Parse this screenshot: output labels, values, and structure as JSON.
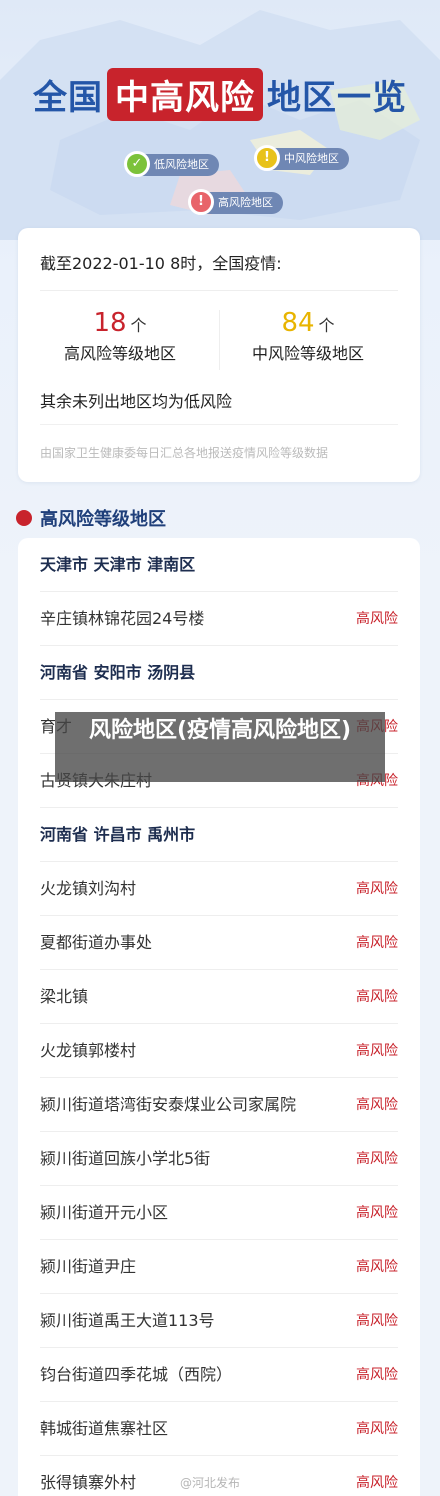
{
  "hero": {
    "title_part1": "全国",
    "title_highlight": "中高风险",
    "title_part2": "地区一览"
  },
  "legend": {
    "low": "低风险地区",
    "mid": "中风险地区",
    "high": "高风险地区"
  },
  "summary": {
    "date_line": "截至2022-01-10 8时，全国疫情:",
    "high_count": "18",
    "high_unit": "个",
    "high_label": "高风险等级地区",
    "mid_count": "84",
    "mid_unit": "个",
    "mid_label": "中风险等级地区",
    "rest_line": "其余未列出地区均为低风险",
    "source": "由国家卫生健康委每日汇总各地报送疫情风险等级数据"
  },
  "section": {
    "title": "高风险等级地区"
  },
  "list": [
    {
      "type": "group",
      "name": "天津市 天津市 津南区"
    },
    {
      "type": "item",
      "name": "辛庄镇林锦花园24号楼",
      "level": "高风险"
    },
    {
      "type": "group",
      "name": "河南省 安阳市 汤阴县"
    },
    {
      "type": "item",
      "name": "育才",
      "level": "高风险"
    },
    {
      "type": "item",
      "name": "古贤镇大朱庄村",
      "level": "高风险"
    },
    {
      "type": "group",
      "name": "河南省 许昌市 禹州市"
    },
    {
      "type": "item",
      "name": "火龙镇刘沟村",
      "level": "高风险"
    },
    {
      "type": "item",
      "name": "夏都街道办事处",
      "level": "高风险"
    },
    {
      "type": "item",
      "name": "梁北镇",
      "level": "高风险"
    },
    {
      "type": "item",
      "name": "火龙镇郭楼村",
      "level": "高风险"
    },
    {
      "type": "item",
      "name": "颍川街道塔湾街安泰煤业公司家属院",
      "level": "高风险"
    },
    {
      "type": "item",
      "name": "颍川街道回族小学北5街",
      "level": "高风险"
    },
    {
      "type": "item",
      "name": "颍川街道开元小区",
      "level": "高风险"
    },
    {
      "type": "item",
      "name": "颍川街道尹庄",
      "level": "高风险"
    },
    {
      "type": "item",
      "name": "颍川街道禹王大道113号",
      "level": "高风险"
    },
    {
      "type": "item",
      "name": "钧台街道四季花城（西院）",
      "level": "高风险"
    },
    {
      "type": "item",
      "name": "韩城街道焦寨社区",
      "level": "高风险"
    },
    {
      "type": "item",
      "name": "张得镇寨外村",
      "level": "高风险"
    }
  ],
  "overlay": {
    "text": "风险地区(疫情高风险地区)"
  },
  "watermark": "@河北发布",
  "colors": {
    "brand_blue": "#2456a8",
    "risk_red": "#c8232c",
    "mid_yellow": "#e8b400",
    "low_green": "#7cc23a"
  }
}
